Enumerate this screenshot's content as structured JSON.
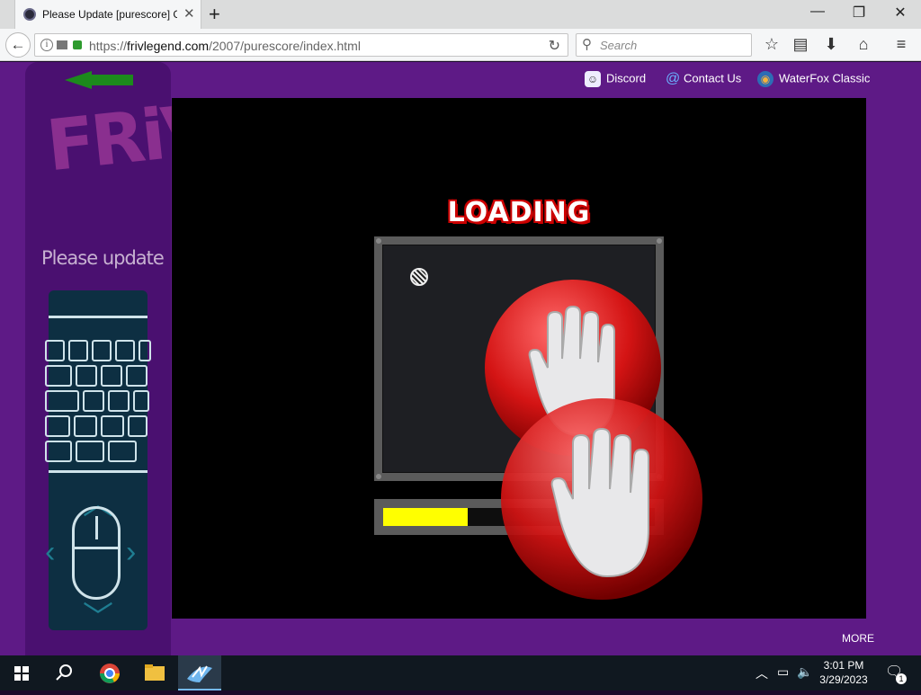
{
  "browser": {
    "tab_title": "Please Update [purescore] G",
    "url_prefix": "https://",
    "url_host": "frivlegend.com",
    "url_path": "/2007/purescore/index.html",
    "search_placeholder": "Search"
  },
  "page": {
    "links": [
      "Discord",
      "Contact Us",
      "WaterFox Classic"
    ],
    "update_text": "Please update pur",
    "loading_text": "LOADING",
    "loading_progress_percent": 31,
    "more_label": "MORE",
    "colors": {
      "background": "#5e1a86",
      "progress": "#ffff00"
    }
  },
  "taskbar": {
    "time": "3:01 PM",
    "date": "3/29/2023",
    "notification_count": "1"
  }
}
